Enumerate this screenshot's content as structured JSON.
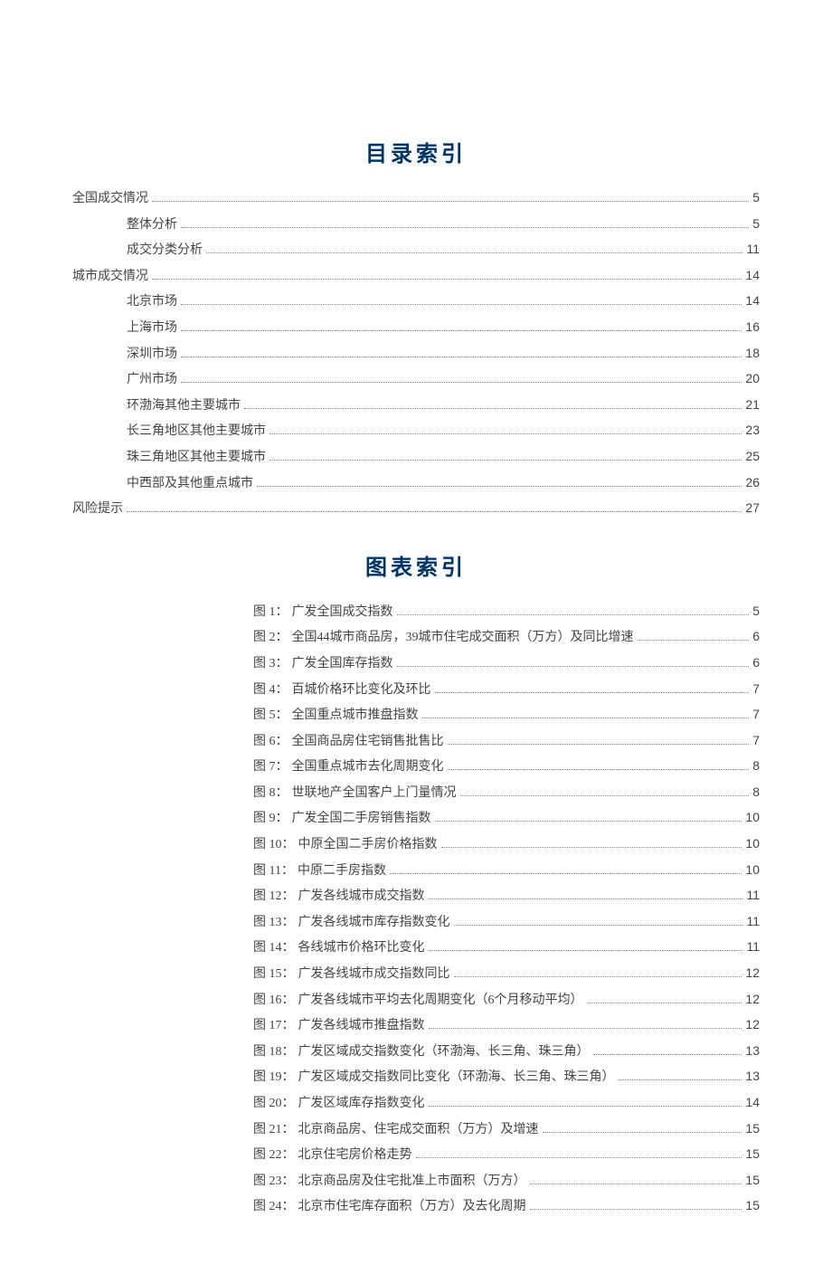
{
  "toc_title": "目录索引",
  "figures_title": "图表索引",
  "toc": [
    {
      "label": "全国成交情况",
      "page": "5",
      "level": 0
    },
    {
      "label": "整体分析",
      "page": "5",
      "level": 1
    },
    {
      "label": "成交分类分析",
      "page": "11",
      "level": 1
    },
    {
      "label": "城市成交情况",
      "page": "14",
      "level": 0
    },
    {
      "label": "北京市场",
      "page": "14",
      "level": 1
    },
    {
      "label": "上海市场",
      "page": "16",
      "level": 1
    },
    {
      "label": "深圳市场",
      "page": "18",
      "level": 1
    },
    {
      "label": "广州市场",
      "page": "20",
      "level": 1
    },
    {
      "label": "环渤海其他主要城市",
      "page": "21",
      "level": 1
    },
    {
      "label": "长三角地区其他主要城市",
      "page": "23",
      "level": 1
    },
    {
      "label": "珠三角地区其他主要城市",
      "page": "25",
      "level": 1
    },
    {
      "label": "中西部及其他重点城市",
      "page": "26",
      "level": 1
    },
    {
      "label": "风险提示",
      "page": "27",
      "level": 0
    }
  ],
  "figures": [
    {
      "num": "图 1：",
      "label": "广发全国成交指数",
      "page": "5"
    },
    {
      "num": "图 2：",
      "label": "全国44城市商品房，39城市住宅成交面积（万方）及同比增速",
      "page": "6"
    },
    {
      "num": "图 3：",
      "label": "广发全国库存指数",
      "page": "6"
    },
    {
      "num": "图 4：",
      "label": "百城价格环比变化及环比",
      "page": "7"
    },
    {
      "num": "图 5：",
      "label": "全国重点城市推盘指数",
      "page": "7"
    },
    {
      "num": "图 6：",
      "label": "全国商品房住宅销售批售比",
      "page": "7"
    },
    {
      "num": "图 7：",
      "label": "全国重点城市去化周期变化",
      "page": "8"
    },
    {
      "num": "图 8：",
      "label": "世联地产全国客户上门量情况",
      "page": "8"
    },
    {
      "num": "图 9：",
      "label": "广发全国二手房销售指数",
      "page": "10"
    },
    {
      "num": "图 10：",
      "label": "中原全国二手房价格指数",
      "page": "10"
    },
    {
      "num": "图 11：",
      "label": "中原二手房指数",
      "page": "10"
    },
    {
      "num": "图 12：",
      "label": "广发各线城市成交指数",
      "page": "11"
    },
    {
      "num": "图 13：",
      "label": "广发各线城市库存指数变化",
      "page": "11"
    },
    {
      "num": "图 14：",
      "label": "各线城市价格环比变化",
      "page": "11"
    },
    {
      "num": "图 15：",
      "label": "广发各线城市成交指数同比",
      "page": "12"
    },
    {
      "num": "图 16：",
      "label": "广发各线城市平均去化周期变化（6个月移动平均）",
      "page": "12"
    },
    {
      "num": "图 17：",
      "label": "广发各线城市推盘指数",
      "page": "12"
    },
    {
      "num": "图 18：",
      "label": "广发区域成交指数变化（环渤海、长三角、珠三角）",
      "page": "13"
    },
    {
      "num": "图 19：",
      "label": "广发区域成交指数同比变化（环渤海、长三角、珠三角）",
      "page": "13"
    },
    {
      "num": "图 20：",
      "label": "广发区域库存指数变化",
      "page": "14"
    },
    {
      "num": "图 21：",
      "label": "北京商品房、住宅成交面积（万方）及增速",
      "page": "15"
    },
    {
      "num": "图 22：",
      "label": "北京住宅房价格走势",
      "page": "15"
    },
    {
      "num": "图 23：",
      "label": "北京商品房及住宅批准上市面积（万方）",
      "page": "15"
    },
    {
      "num": "图 24：",
      "label": "北京市住宅库存面积（万方）及去化周期",
      "page": "15"
    }
  ]
}
